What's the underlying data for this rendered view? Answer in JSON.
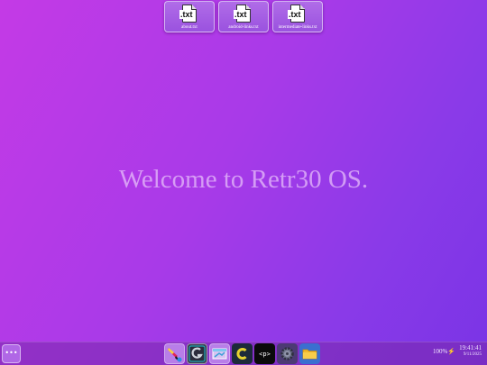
{
  "desktop": {
    "files": [
      {
        "icon": "txt-file-icon",
        "ext": ".txt",
        "name": "about.txt"
      },
      {
        "icon": "txt-file-icon",
        "ext": ".txt",
        "name": "android-links.txt"
      },
      {
        "icon": "txt-file-icon",
        "ext": ".txt",
        "name": "intermediate-links.txt"
      }
    ],
    "welcome_text": "Welcome to Retr30 OS."
  },
  "taskbar": {
    "start_label": "•••",
    "apps": [
      {
        "name": "brush-app",
        "icon": "paintbrush-icon"
      },
      {
        "name": "g-app",
        "icon": "g-logo-icon"
      },
      {
        "name": "window-app",
        "icon": "window-icon"
      },
      {
        "name": "c-app",
        "icon": "c-logo-icon"
      },
      {
        "name": "code-editor",
        "icon": "code-icon",
        "label": "<p>"
      },
      {
        "name": "settings",
        "icon": "gear-icon"
      },
      {
        "name": "file-manager",
        "icon": "folder-icon"
      }
    ],
    "battery": "100%",
    "time": "19:41:41",
    "date": "9/11/2025"
  }
}
